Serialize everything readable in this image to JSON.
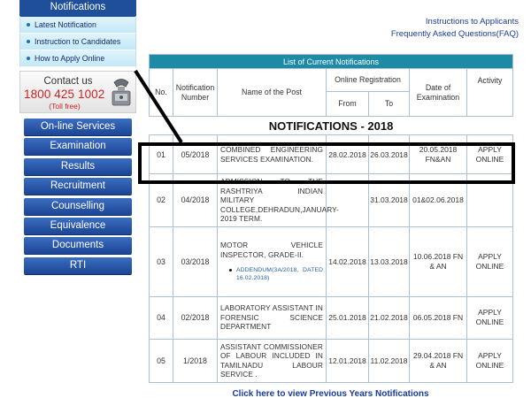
{
  "sidebar": {
    "notifications_title": "Notifications",
    "links": [
      {
        "label": "Latest Notification"
      },
      {
        "label": "Instruction to Candidates"
      },
      {
        "label": "How to Apply Online"
      }
    ],
    "contact": {
      "title": "Contact us",
      "phone": "1800 425 1002",
      "toll_free": "(Toll free)",
      "icon": "telephone-icon"
    },
    "menu": [
      {
        "label": "On-line Services"
      },
      {
        "label": "Examination"
      },
      {
        "label": "Results"
      },
      {
        "label": "Recruitment"
      },
      {
        "label": "Counselling"
      },
      {
        "label": "Equivalence"
      },
      {
        "label": "Documents"
      },
      {
        "label": "RTI"
      }
    ]
  },
  "top_links": {
    "instructions": "Instructions to Applicants",
    "faq": "Frequently Asked Questions(FAQ)"
  },
  "table": {
    "caption": "List of Current Notifications",
    "headers": {
      "no": "No.",
      "notification_number": "Notification Number",
      "post_name": "Name of the Post",
      "online_registration": "Online Registration",
      "from": "From",
      "to": "To",
      "exam_date": "Date of Examination",
      "activity": "Activity"
    },
    "section_title": "NOTIFICATIONS - 2018",
    "rows": [
      {
        "no": "01",
        "number": "05/2018",
        "post": "COMBINED ENGINEERING SERVICES EXAMINATION.",
        "from": "28.02.2018",
        "to": "26.03.2018",
        "exam": "20.05.2018 FN&AN",
        "action": "APPLY ONLINE"
      },
      {
        "no": "02",
        "number": "04/2018",
        "post": "ADMISSION TO THE RASHTRIYA INDIAN MILITARY COLLEGE,DEHRADUN,JANUARY-2019 TERM.",
        "from": "",
        "to": "31.03.2018",
        "exam": "01&02.06.2018",
        "action": ""
      },
      {
        "no": "03",
        "number": "03/2018",
        "post": "MOTOR VEHICLE INSPECTOR, GRADE-II.",
        "addendum": "ADDENDUM(3A/2018, DATED 16.02.2018)",
        "from": "14.02.2018",
        "to": "13.03.2018",
        "exam": "10.06.2018 FN & AN",
        "action": "APPLY ONLINE"
      },
      {
        "no": "04",
        "number": "02/2018",
        "post": "LABORATORY ASSISTANT IN FORENSIC SCIENCE DEPARTMENT",
        "from": "25.01.2018",
        "to": "21.02.2018",
        "exam": "06.05.2018 FN",
        "action": "APPLY ONLINE"
      },
      {
        "no": "05",
        "number": "1/2018",
        "post": "ASSISTANT COMMISSIONER OF LABOUR INCLUDED IN TAMILNADU LABOUR SERVICE .",
        "from": "12.01.2018",
        "to": "11.02.2018",
        "exam": "29.04.2018 FN & AN",
        "action": "APPLY ONLINE"
      }
    ]
  },
  "footer_link": "Click here to view Previous Years Notifications",
  "colors": {
    "menu_blue": "#1c4595",
    "table_caption": "#1d8aa6",
    "link_blue": "#1f5fa8",
    "phone_red": "#d21f1f"
  }
}
